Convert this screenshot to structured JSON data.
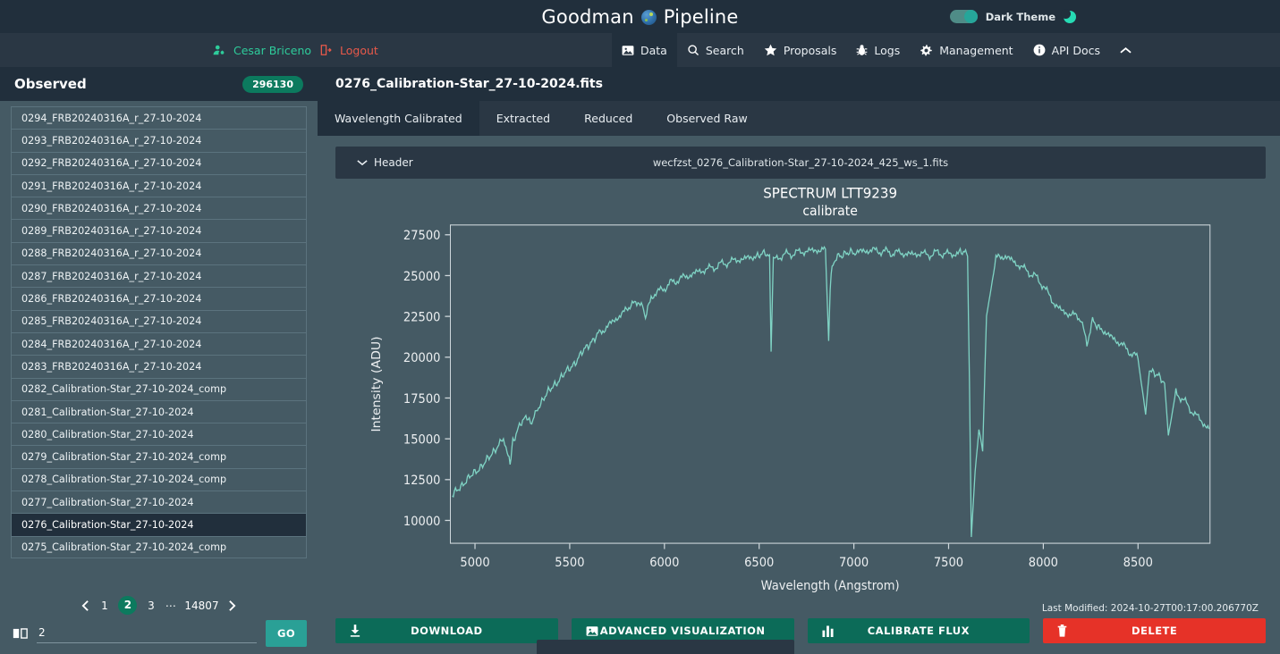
{
  "brand": {
    "title_left": "Goodman",
    "title_right": "Pipeline",
    "logo_icon": "globe-icon",
    "theme_label": "Dark Theme",
    "theme_icon": "moon-icon",
    "theme_enabled": true
  },
  "nav": {
    "user_icon": "user-settings-icon",
    "user_name": "Cesar Briceno",
    "logout_icon": "logout-icon",
    "logout_label": "Logout",
    "items": [
      {
        "label": "Data",
        "icon": "image-icon",
        "active": true
      },
      {
        "label": "Search",
        "icon": "search-icon",
        "active": false
      },
      {
        "label": "Proposals",
        "icon": "star-icon",
        "active": false
      },
      {
        "label": "Logs",
        "icon": "bug-icon",
        "active": false
      },
      {
        "label": "Management",
        "icon": "gear-icon",
        "active": false
      },
      {
        "label": "API Docs",
        "icon": "info-icon",
        "active": false
      }
    ],
    "collapse_icon": "chevron-up-icon"
  },
  "sidebar": {
    "title": "Observed",
    "count_badge": "296130",
    "items": [
      "0294_FRB20240316A_r_27-10-2024",
      "0293_FRB20240316A_r_27-10-2024",
      "0292_FRB20240316A_r_27-10-2024",
      "0291_FRB20240316A_r_27-10-2024",
      "0290_FRB20240316A_r_27-10-2024",
      "0289_FRB20240316A_r_27-10-2024",
      "0288_FRB20240316A_r_27-10-2024",
      "0287_FRB20240316A_r_27-10-2024",
      "0286_FRB20240316A_r_27-10-2024",
      "0285_FRB20240316A_r_27-10-2024",
      "0284_FRB20240316A_r_27-10-2024",
      "0283_FRB20240316A_r_27-10-2024",
      "0282_Calibration-Star_27-10-2024_comp",
      "0281_Calibration-Star_27-10-2024",
      "0280_Calibration-Star_27-10-2024",
      "0279_Calibration-Star_27-10-2024_comp",
      "0278_Calibration-Star_27-10-2024_comp",
      "0277_Calibration-Star_27-10-2024",
      "0276_Calibration-Star_27-10-2024",
      "0275_Calibration-Star_27-10-2024_comp"
    ],
    "selected_index": 18,
    "pagination": {
      "prev_icon": "chevron-left-icon",
      "next_icon": "chevron-right-icon",
      "pages": [
        "1",
        "2",
        "3",
        "⋯",
        "14807"
      ],
      "current_page": "2"
    },
    "goto": {
      "icon": "book-icon",
      "value": "2",
      "placeholder": "",
      "button_label": "GO"
    }
  },
  "main": {
    "file_title": "0276_Calibration-Star_27-10-2024.fits",
    "tabs": [
      {
        "label": "Wavelength Calibrated",
        "active": true
      },
      {
        "label": "Extracted",
        "active": false
      },
      {
        "label": "Reduced",
        "active": false
      },
      {
        "label": "Observed Raw",
        "active": false
      }
    ],
    "header_accordion": {
      "chevron_icon": "chevron-down-icon",
      "label": "Header",
      "filename": "wecfzst_0276_Calibration-Star_27-10-2024_425_ws_1.fits"
    },
    "last_modified": "Last Modified: 2024-10-27T00:17:00.206770Z",
    "actions": [
      {
        "label": "DOWNLOAD",
        "icon": "download-icon",
        "variant": "primary"
      },
      {
        "label": "ADVANCED VISUALIZATION",
        "icon": "image-icon",
        "variant": "primary"
      },
      {
        "label": "CALIBRATE FLUX",
        "icon": "bar-chart-icon",
        "variant": "primary"
      },
      {
        "label": "DELETE",
        "icon": "trash-icon",
        "variant": "danger"
      }
    ]
  },
  "colors": {
    "accent_teal": "#26a69a",
    "brand_green": "#0c7a5e",
    "danger_red": "#e63228",
    "panel_dark": "#212f3c",
    "panel_mid": "#2a3744",
    "background_slate": "#455a64",
    "spectrum_line": "#7fd3c4",
    "user_name": "#2ecc9b",
    "logout": "#e8594a"
  },
  "chart_data": {
    "type": "line",
    "title": "SPECTRUM LTT9239",
    "subtitle": "calibrate",
    "xlabel": "Wavelength (Angstrom)",
    "ylabel": "Intensity (ADU)",
    "xlim": [
      4870,
      8880
    ],
    "ylim": [
      8600,
      28100
    ],
    "xticks": [
      5000,
      5500,
      6000,
      6500,
      7000,
      7500,
      8000,
      8500
    ],
    "yticks": [
      10000,
      12500,
      15000,
      17500,
      20000,
      22500,
      25000,
      27500
    ],
    "grid": false,
    "legend": "none",
    "line_color": "#7fd3c4",
    "series": [
      {
        "name": "calibrate",
        "x": [
          4880,
          4920,
          4960,
          5000,
          5040,
          5080,
          5120,
          5150,
          5170,
          5185,
          5200,
          5240,
          5280,
          5300,
          5330,
          5370,
          5410,
          5450,
          5490,
          5530,
          5570,
          5610,
          5650,
          5700,
          5750,
          5800,
          5860,
          5890,
          5900,
          5930,
          5980,
          6030,
          6080,
          6130,
          6180,
          6230,
          6280,
          6330,
          6380,
          6430,
          6480,
          6520,
          6555,
          6563,
          6575,
          6600,
          6650,
          6700,
          6750,
          6800,
          6850,
          6867,
          6875,
          6890,
          6920,
          6960,
          7000,
          7050,
          7100,
          7150,
          7200,
          7250,
          7300,
          7350,
          7400,
          7450,
          7500,
          7550,
          7590,
          7600,
          7610,
          7620,
          7640,
          7660,
          7680,
          7700,
          7750,
          7800,
          7850,
          7900,
          7950,
          8000,
          8050,
          8100,
          8150,
          8200,
          8230,
          8260,
          8300,
          8350,
          8400,
          8450,
          8500,
          8540,
          8560,
          8600,
          8640,
          8660,
          8700,
          8750,
          8800,
          8850,
          8875
        ],
        "y": [
          11500,
          12050,
          12500,
          12950,
          13400,
          13900,
          14600,
          15050,
          14300,
          13450,
          14900,
          15900,
          16400,
          16000,
          16900,
          17600,
          18200,
          18700,
          19200,
          19700,
          20350,
          20900,
          21400,
          21900,
          22400,
          22900,
          23450,
          23000,
          22300,
          23700,
          24100,
          24500,
          24800,
          25000,
          25250,
          25400,
          25600,
          25800,
          25950,
          26050,
          26200,
          26300,
          26250,
          20350,
          25900,
          26150,
          26300,
          26400,
          26500,
          26550,
          26600,
          21000,
          24400,
          25900,
          26250,
          26350,
          26400,
          26500,
          26550,
          26480,
          26400,
          26380,
          26300,
          26350,
          26280,
          26400,
          26300,
          26350,
          26450,
          26200,
          18500,
          9000,
          13000,
          15500,
          14200,
          22500,
          26050,
          26200,
          25800,
          25400,
          25000,
          24400,
          23400,
          22800,
          22600,
          22400,
          20800,
          22200,
          21800,
          21300,
          20900,
          20400,
          19900,
          16500,
          19300,
          18900,
          18400,
          15200,
          17900,
          17200,
          16500,
          15900,
          15600
        ]
      }
    ],
    "absorption_lines": [
      {
        "wavelength": 5175,
        "depth_adu": 13450
      },
      {
        "wavelength": 5895,
        "depth_adu": 22300
      },
      {
        "wavelength": 6563,
        "depth_adu": 20350
      },
      {
        "wavelength": 6867,
        "depth_adu": 21000
      },
      {
        "wavelength": 7610,
        "depth_adu": 9000
      },
      {
        "wavelength": 8540,
        "depth_adu": 16500
      },
      {
        "wavelength": 8660,
        "depth_adu": 15200
      }
    ]
  }
}
